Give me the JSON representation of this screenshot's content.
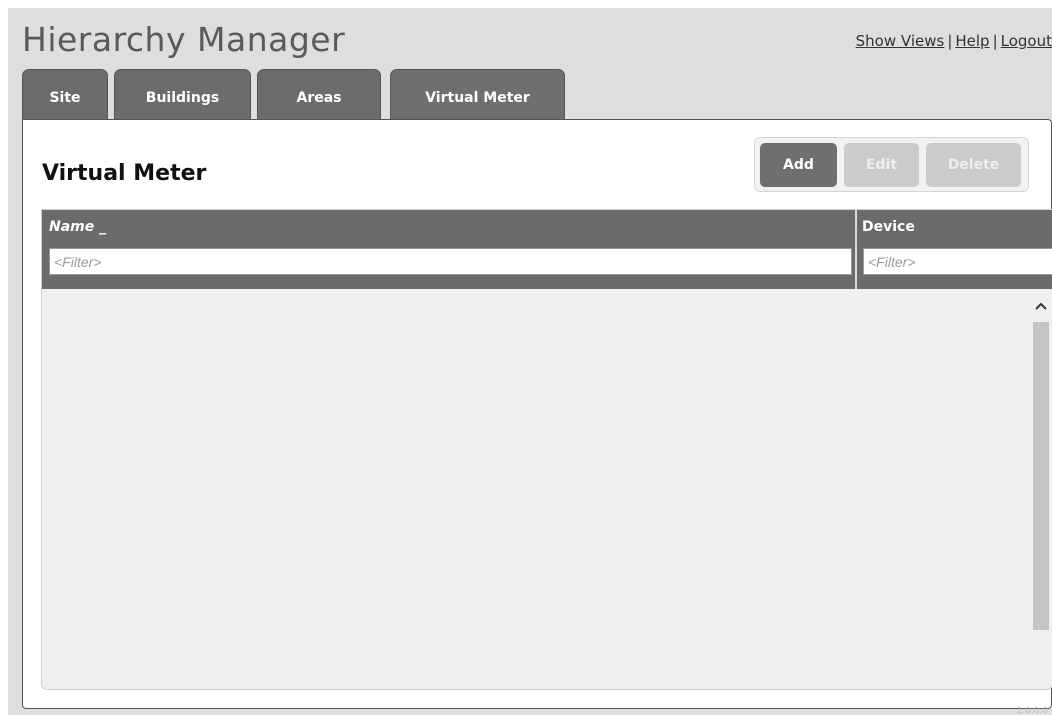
{
  "app": {
    "title": "Hierarchy Manager",
    "version": "1.0.0.0"
  },
  "top_links": {
    "show_views": "Show Views",
    "help": "Help",
    "logout": "Logout",
    "separator": "|"
  },
  "tabs": [
    {
      "label": "Site",
      "active": false
    },
    {
      "label": "Buildings",
      "active": false
    },
    {
      "label": "Areas",
      "active": false
    },
    {
      "label": "Virtual Meter",
      "active": true
    }
  ],
  "panel": {
    "title": "Virtual Meter",
    "buttons": {
      "add": {
        "label": "Add",
        "enabled": true
      },
      "edit": {
        "label": "Edit",
        "enabled": false
      },
      "delete": {
        "label": "Delete",
        "enabled": false
      }
    }
  },
  "grid": {
    "columns": [
      {
        "header": "Name",
        "sort_indicator": "_",
        "filter_value": "",
        "filter_placeholder": "<Filter>"
      },
      {
        "header": "Device",
        "sort_indicator": "",
        "filter_value": "",
        "filter_placeholder": "<Filter>"
      }
    ],
    "rows": []
  },
  "icons": {
    "scroll_up": "chevron-up-icon"
  },
  "colors": {
    "page_bg": "#dedede",
    "tab_bg": "#6c6c6c",
    "header_bg": "#6b6b6b",
    "button_enabled": "#6f6f6f",
    "button_disabled": "#cbcbcb",
    "grid_body_bg": "#efefef",
    "scroll_thumb": "#c4c4c4"
  }
}
